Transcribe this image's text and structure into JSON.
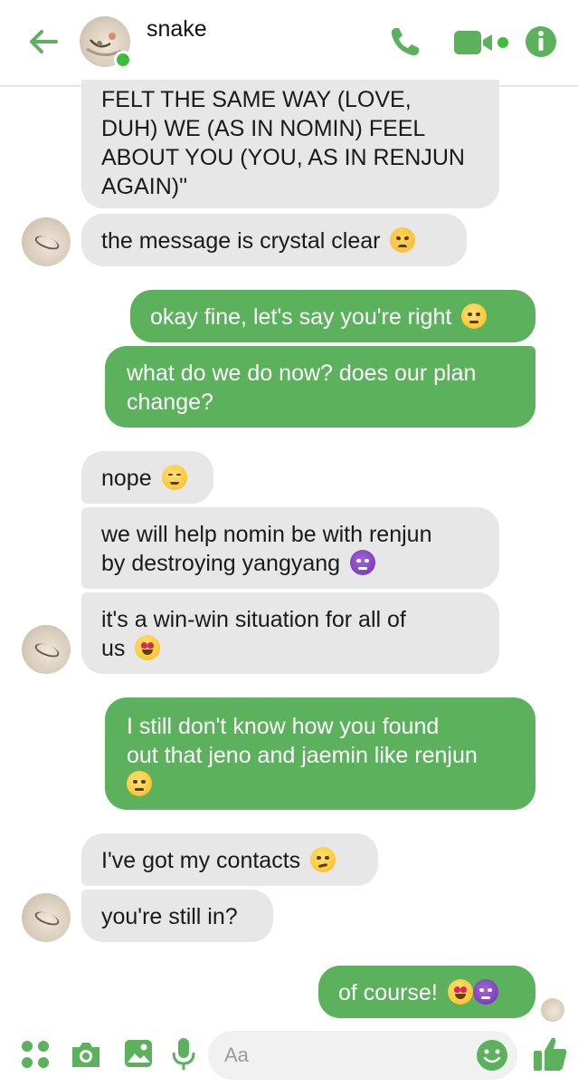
{
  "colors": {
    "accent": "#5cb15c",
    "incoming_bubble": "#e7e7e7",
    "online": "#3bbf3b"
  },
  "header": {
    "contact_name": "snake",
    "icons": [
      "back-arrow-icon",
      "phone-icon",
      "video-camera-icon",
      "info-icon"
    ]
  },
  "messages": [
    {
      "from": "them",
      "lines": [
        "FELT THE SAME WAY (LOVE,",
        "DUH) WE (AS IN NOMIN) FEEL",
        "ABOUT YOU (YOU, AS IN RENJUN",
        "AGAIN)\""
      ]
    },
    {
      "from": "them",
      "text": "the message is crystal clear",
      "emoji": "angry-face"
    },
    {
      "from": "me",
      "text": "okay fine, let's say you're right",
      "emoji": "unamused-face"
    },
    {
      "from": "me",
      "lines": [
        "what do we do now? does our plan",
        "change?"
      ]
    },
    {
      "from": "them",
      "text": "nope",
      "emoji": "relieved-face"
    },
    {
      "from": "them",
      "lines": [
        "we will help nomin be with renjun",
        "by destroying yangyang"
      ],
      "emoji": "smiling-devil"
    },
    {
      "from": "them",
      "lines": [
        "it's a win-win situation for all of",
        "us"
      ],
      "emoji": "star-struck-face"
    },
    {
      "from": "me",
      "lines": [
        "I still don't know how you found",
        "out that jeno and jaemin like renjun"
      ],
      "emoji": "raised-eyebrow-face"
    },
    {
      "from": "them",
      "text": "I've got my contacts",
      "emoji": "smirking-face"
    },
    {
      "from": "them",
      "text": "you're still in?"
    },
    {
      "from": "me",
      "text": "of course!",
      "emoji": "star-struck-and-devil"
    }
  ],
  "composer": {
    "placeholder": "Aa",
    "icons": [
      "apps-icon",
      "camera-icon",
      "image-icon",
      "microphone-icon",
      "emoji-icon",
      "thumbs-up-icon"
    ]
  }
}
